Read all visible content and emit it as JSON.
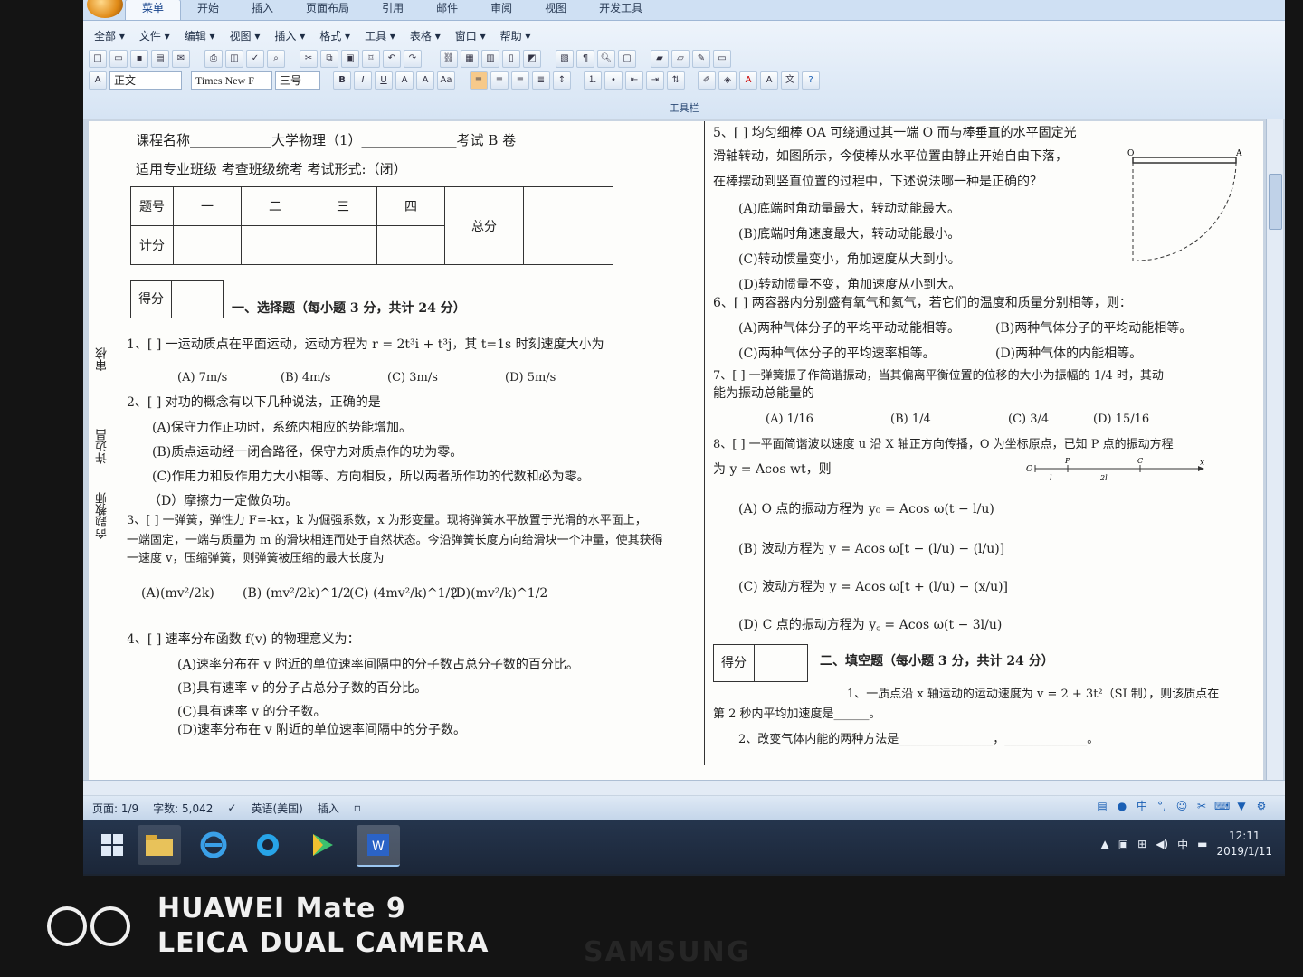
{
  "ribbon": {
    "tabs": [
      "菜单",
      "开始",
      "插入",
      "页面布局",
      "引用",
      "邮件",
      "审阅",
      "视图",
      "开发工具"
    ],
    "active_tab": "菜单",
    "menu": [
      "全部 ▾",
      "文件 ▾",
      "编辑 ▾",
      "视图 ▾",
      "插入 ▾",
      "格式 ▾",
      "工具 ▾",
      "表格 ▾",
      "窗口 ▾",
      "帮助 ▾"
    ],
    "style_select": "正文",
    "font_select": "Times New F",
    "size_select": "三号",
    "group_label": "工具栏"
  },
  "left": {
    "course": "课程名称____________大学物理（1）______________考试 B 卷",
    "major": "适用专业班级 考查班级统考 考试形式:（闭）",
    "score_table": {
      "row1": [
        "题号",
        "一",
        "二",
        "三",
        "四",
        "总分"
      ],
      "row2_label": "计分"
    },
    "score_label": "得分",
    "section1": "一、选择题（每小题 3 分，共计 24 分）",
    "q1": "1、[        ] 一运动质点在平面运动，运动方程为 r = 2t³i + t³j，其 t=1s 时刻速度大小为",
    "q1_opts": [
      "(A) 7m/s",
      "(B)   4m/s",
      "(C)   3m/s",
      "(D)   5m/s"
    ],
    "q2": "2、[    ] 对功的概念有以下几种说法，正确的是",
    "q2_opts": [
      "(A)保守力作正功时，系统内相应的势能增加。",
      "(B)质点运动经一闭合路径，保守力对质点作的功为零。",
      "(C)作用力和反作用力大小相等、方向相反，所以两者所作功的代数和必为零。",
      "（D）摩擦力一定做负功。"
    ],
    "q3_lines": [
      "3、[    ] 一弹簧，弹性力 F=-kx，k 为倔强系数，x 为形变量。现将弹簧水平放置于光滑的水平面上，",
      "一端固定，一端与质量为 m 的滑块相连而处于自然状态。今沿弹簧长度方向给滑块一个冲量，使其获得",
      "一速度 v，压缩弹簧，则弹簧被压缩的最大长度为"
    ],
    "q3_opts": [
      "(A)(mv²/2k)",
      "(B) (mv²/2k)^1/2",
      "(C) (4mv²/k)^1/2",
      "(D)(mv²/k)^1/2"
    ],
    "q4": "4、[    ] 速率分布函数 f(v) 的物理意义为：",
    "q4_opts": [
      "(A)速率分布在 v 附近的单位速率间隔中的分子数占总分子数的百分比。",
      "(B)具有速率 v 的分子占总分子数的百分比。",
      "(C)具有速率 v 的分子数。",
      "(D)速率分布在 v 附近的单位速率间隔中的分子数。"
    ],
    "margin": [
      "审核",
      "许迈昌",
      "命题教师"
    ]
  },
  "right": {
    "q5_lines": [
      "5、[        ] 均匀细棒 OA 可绕通过其一端 O 而与棒垂直的水平固定光",
      "滑轴转动，如图所示，今使棒从水平位置由静止开始自由下落，",
      "在棒摆动到竖直位置的过程中，下述说法哪一种是正确的？"
    ],
    "q5_opts": [
      "(A)底端时角动量最大，转动动能最大。",
      "(B)底端时角速度最大，转动动能最小。",
      "(C)转动惯量变小，角加速度从大到小。",
      "(D)转动惯量不变，角加速度从小到大。"
    ],
    "q6": "6、[      ] 两容器内分别盛有氧气和氦气，若它们的温度和质量分别相等，则：",
    "q6_opts": [
      "(A)两种气体分子的平均平动动能相等。",
      "(B)两种气体分子的平均动能相等。",
      "(C)两种气体分子的平均速率相等。",
      "(D)两种气体的内能相等。"
    ],
    "q7_lines": [
      "7、[        ] 一弹簧振子作简谐振动，当其偏离平衡位置的位移的大小为振幅的 1/4 时，其动",
      "能为振动总能量的"
    ],
    "q7_opts": [
      "(A) 1/16",
      "(B) 1/4",
      "(C) 3/4",
      "(D) 15/16"
    ],
    "q8_lines": [
      "8、[        ] 一平面简谐波以速度 u 沿 X 轴正方向传播，O 为坐标原点，已知 P 点的振动方程",
      "为 y = Acos wt，则"
    ],
    "q8_opts": [
      "(A) O 点的振动方程为 y₀ = Acos ω(t − l/u)",
      "(B)  波动方程为 y = Acos ω[t − (l/u) − (l/u)]",
      "(C)  波动方程为 y = Acos ω[t + (l/u) − (x/u)]",
      "(D) C 点的振动方程为 y꜀ = Acos ω(t − 3l/u)"
    ],
    "axis_labels": {
      "o": "O",
      "p": "P",
      "c": "C",
      "x": "x",
      "l": "l",
      "l2": "2l"
    },
    "rod_labels": {
      "o": "O",
      "a": "A"
    },
    "score_label": "得分",
    "section2": "二、填空题（每小题 3 分，共计 24 分）",
    "f1_a": "1、一质点沿 x 轴运动的运动速度为 v = 2 + 3t²（SI 制），则该质点在",
    "f1_b": "第 2 秒内平均加速度是______。",
    "f2": "2、改变气体内能的两种方法是________________，______________。"
  },
  "status": {
    "page": "页面: 1/9",
    "words": "字数: 5,042",
    "lang": "英语(美国)",
    "mode": "插入"
  },
  "ime": {
    "zh": "中"
  },
  "tray": {
    "ime": "中",
    "time": "12:11",
    "date": "2019/1/11"
  },
  "watermark": {
    "line1": "HUAWEI Mate 9",
    "line2": "LEICA DUAL CAMERA"
  },
  "monitor_brand": "SAMSUNG"
}
